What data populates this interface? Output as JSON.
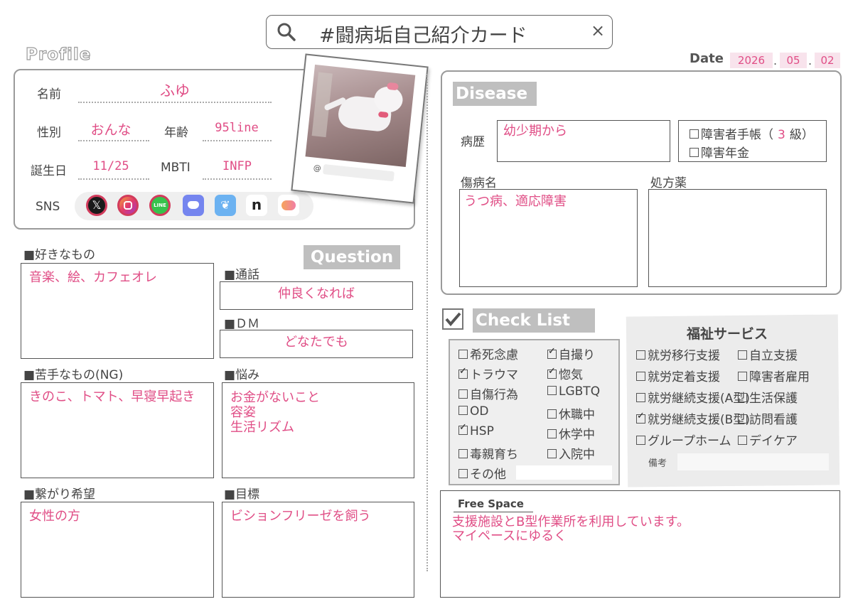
{
  "header": {
    "search_text": "#闘病垢自己紹介カード",
    "close_symbol": "×"
  },
  "date": {
    "label": "Date",
    "year": "2026",
    "month": "05",
    "day": "02",
    "sep": "."
  },
  "profile": {
    "banner": "Profile",
    "name_label": "名前",
    "name": "ふゆ",
    "gender_label": "性別",
    "gender": "おんな",
    "age_label": "年齢",
    "age": "95line",
    "birthday_label": "誕生日",
    "birthday": "11/25",
    "mbti_label": "MBTI",
    "mbti": "INFP",
    "sns_label": "SNS",
    "sns_icons": [
      "x-icon",
      "instagram-icon",
      "line-icon",
      "discord-icon",
      "bluesky-icon",
      "note-icon",
      "misskey-icon"
    ],
    "photo_handle": "@"
  },
  "likes": {
    "title": "■好きなもの",
    "text": "音楽、絵、カフェオレ"
  },
  "dislikes": {
    "title": "■苦手なもの(NG)",
    "text": "きのこ、トマト、早寝早起き"
  },
  "connection": {
    "title": "■繋がり希望",
    "text": "女性の方"
  },
  "question": {
    "banner": "Question",
    "call_title": "■通話",
    "call": "仲良くなれば",
    "dm_title": "■ＤＭ",
    "dm": "どなたでも",
    "worries_title": "■悩み",
    "worries": [
      "お金がないこと",
      "容姿",
      "生活リズム"
    ],
    "goal_title": "■目標",
    "goal": "ビションフリーゼを飼う"
  },
  "disease": {
    "banner": "Disease",
    "history_label": "病歴",
    "history": "幼少期から",
    "handbook_label": "障害者手帳（",
    "handbook_grade": "3",
    "handbook_suffix": "級）",
    "pension_label": "障害年金",
    "diagnosis_label": "傷病名",
    "diagnosis": "うつ病、適応障害",
    "medication_label": "処方薬",
    "medication": ""
  },
  "checklist": {
    "banner": "Check List",
    "left": [
      {
        "label": "希死念慮",
        "checked": false
      },
      {
        "label": "トラウマ",
        "checked": true
      },
      {
        "label": "自傷行為",
        "checked": false
      },
      {
        "label": "OD",
        "checked": false
      },
      {
        "label": "HSP",
        "checked": true
      },
      {
        "label": "毒親育ち",
        "checked": false
      },
      {
        "label": "その他",
        "checked": false
      }
    ],
    "right": [
      {
        "label": "自撮り",
        "checked": true
      },
      {
        "label": "惚気",
        "checked": true
      },
      {
        "label": "LGBTQ",
        "checked": false
      },
      {
        "label": "休職中",
        "checked": false
      },
      {
        "label": "休学中",
        "checked": false
      },
      {
        "label": "入院中",
        "checked": false
      }
    ]
  },
  "welfare": {
    "title": "福祉サービス",
    "left": [
      {
        "label": "就労移行支援",
        "checked": false
      },
      {
        "label": "就労定着支援",
        "checked": false
      },
      {
        "label": "就労継続支援(A型)",
        "checked": false
      },
      {
        "label": "就労継続支援(B型)",
        "checked": true
      },
      {
        "label": "グループホーム",
        "checked": false
      }
    ],
    "right": [
      {
        "label": "自立支援",
        "checked": false
      },
      {
        "label": "障害者雇用",
        "checked": false
      },
      {
        "label": "生活保護",
        "checked": false
      },
      {
        "label": "訪問看護",
        "checked": false
      },
      {
        "label": "デイケア",
        "checked": false
      }
    ],
    "notes_label": "備考"
  },
  "free_space": {
    "title": "Free Space",
    "lines": [
      "支援施設とB型作業所を利用しています。",
      "マイペースにゆるく"
    ]
  }
}
